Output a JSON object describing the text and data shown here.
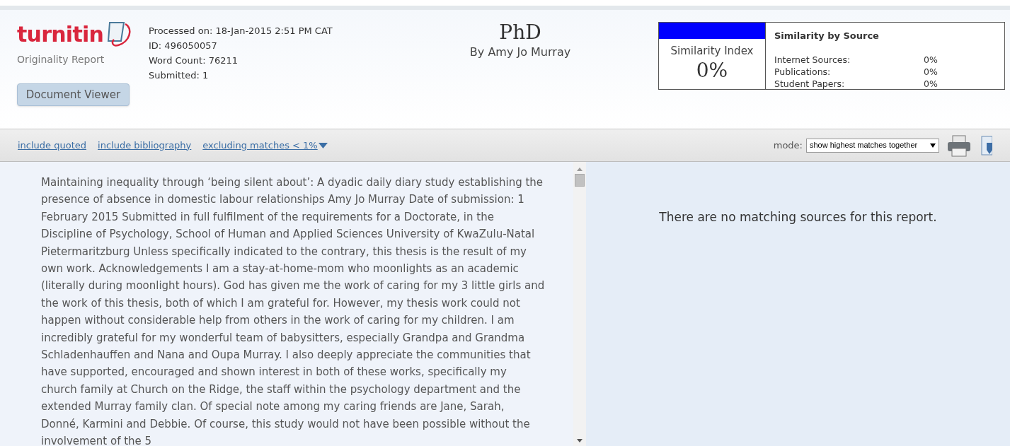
{
  "header": {
    "logo": "turnitin",
    "subtitle": "Originality Report",
    "document_viewer_button": "Document Viewer",
    "meta": [
      "Processed on: 18-Jan-2015 2:51 PM CAT",
      "ID: 496050057",
      "Word Count: 76211",
      "Submitted: 1"
    ],
    "title": "PhD",
    "author": "By Amy Jo Murray",
    "similarity_index": {
      "label": "Similarity Index",
      "value": "0%"
    },
    "similarity_by_source": {
      "title": "Similarity by Source",
      "rows": [
        {
          "label": "Internet Sources:",
          "value": "0%"
        },
        {
          "label": "Publications:",
          "value": "0%"
        },
        {
          "label": "Student Papers:",
          "value": "0%"
        }
      ]
    }
  },
  "toolbar": {
    "links": [
      "include quoted",
      "include bibliography",
      "excluding matches < 1%"
    ],
    "mode_label": "mode:",
    "mode_value": "show highest matches together"
  },
  "document_text": "Maintaining inequality through ‘being silent about’: A dyadic daily diary study establishing the presence of absence in domestic labour relationships Amy Jo Murray Date of submission: 1 February 2015 Submitted in full fulfilment of the requirements for a Doctorate, in the Discipline of Psychology, School of Human and Applied Sciences University of KwaZulu-Natal Pietermaritzburg Unless specifically indicated to the contrary, this thesis is the result of my own work. Acknowledgements I am a stay-at-home-mom who moonlights as an academic (literally during moonlight hours). God has given me the work of caring for my 3 little girls and the work of this thesis, both of which I am grateful for. However, my thesis work could not happen without considerable help from others in the work of caring for my children. I am incredibly grateful for my wonderful team of babysitters, especially Grandpa and Grandma Schladenhauffen and Nana and Oupa Murray. I also deeply appreciate the communities that have supported, encouraged and shown interest in both of these works, specifically my church family at Church on the Ridge, the staff within the psychology department and the extended Murray family clan. Of special note among my caring friends are Jane, Sarah, Donné, Karmini and Debbie. Of course, this study would not have been possible without the involvement of the 5",
  "sources_message": "There are no matching sources for this report."
}
